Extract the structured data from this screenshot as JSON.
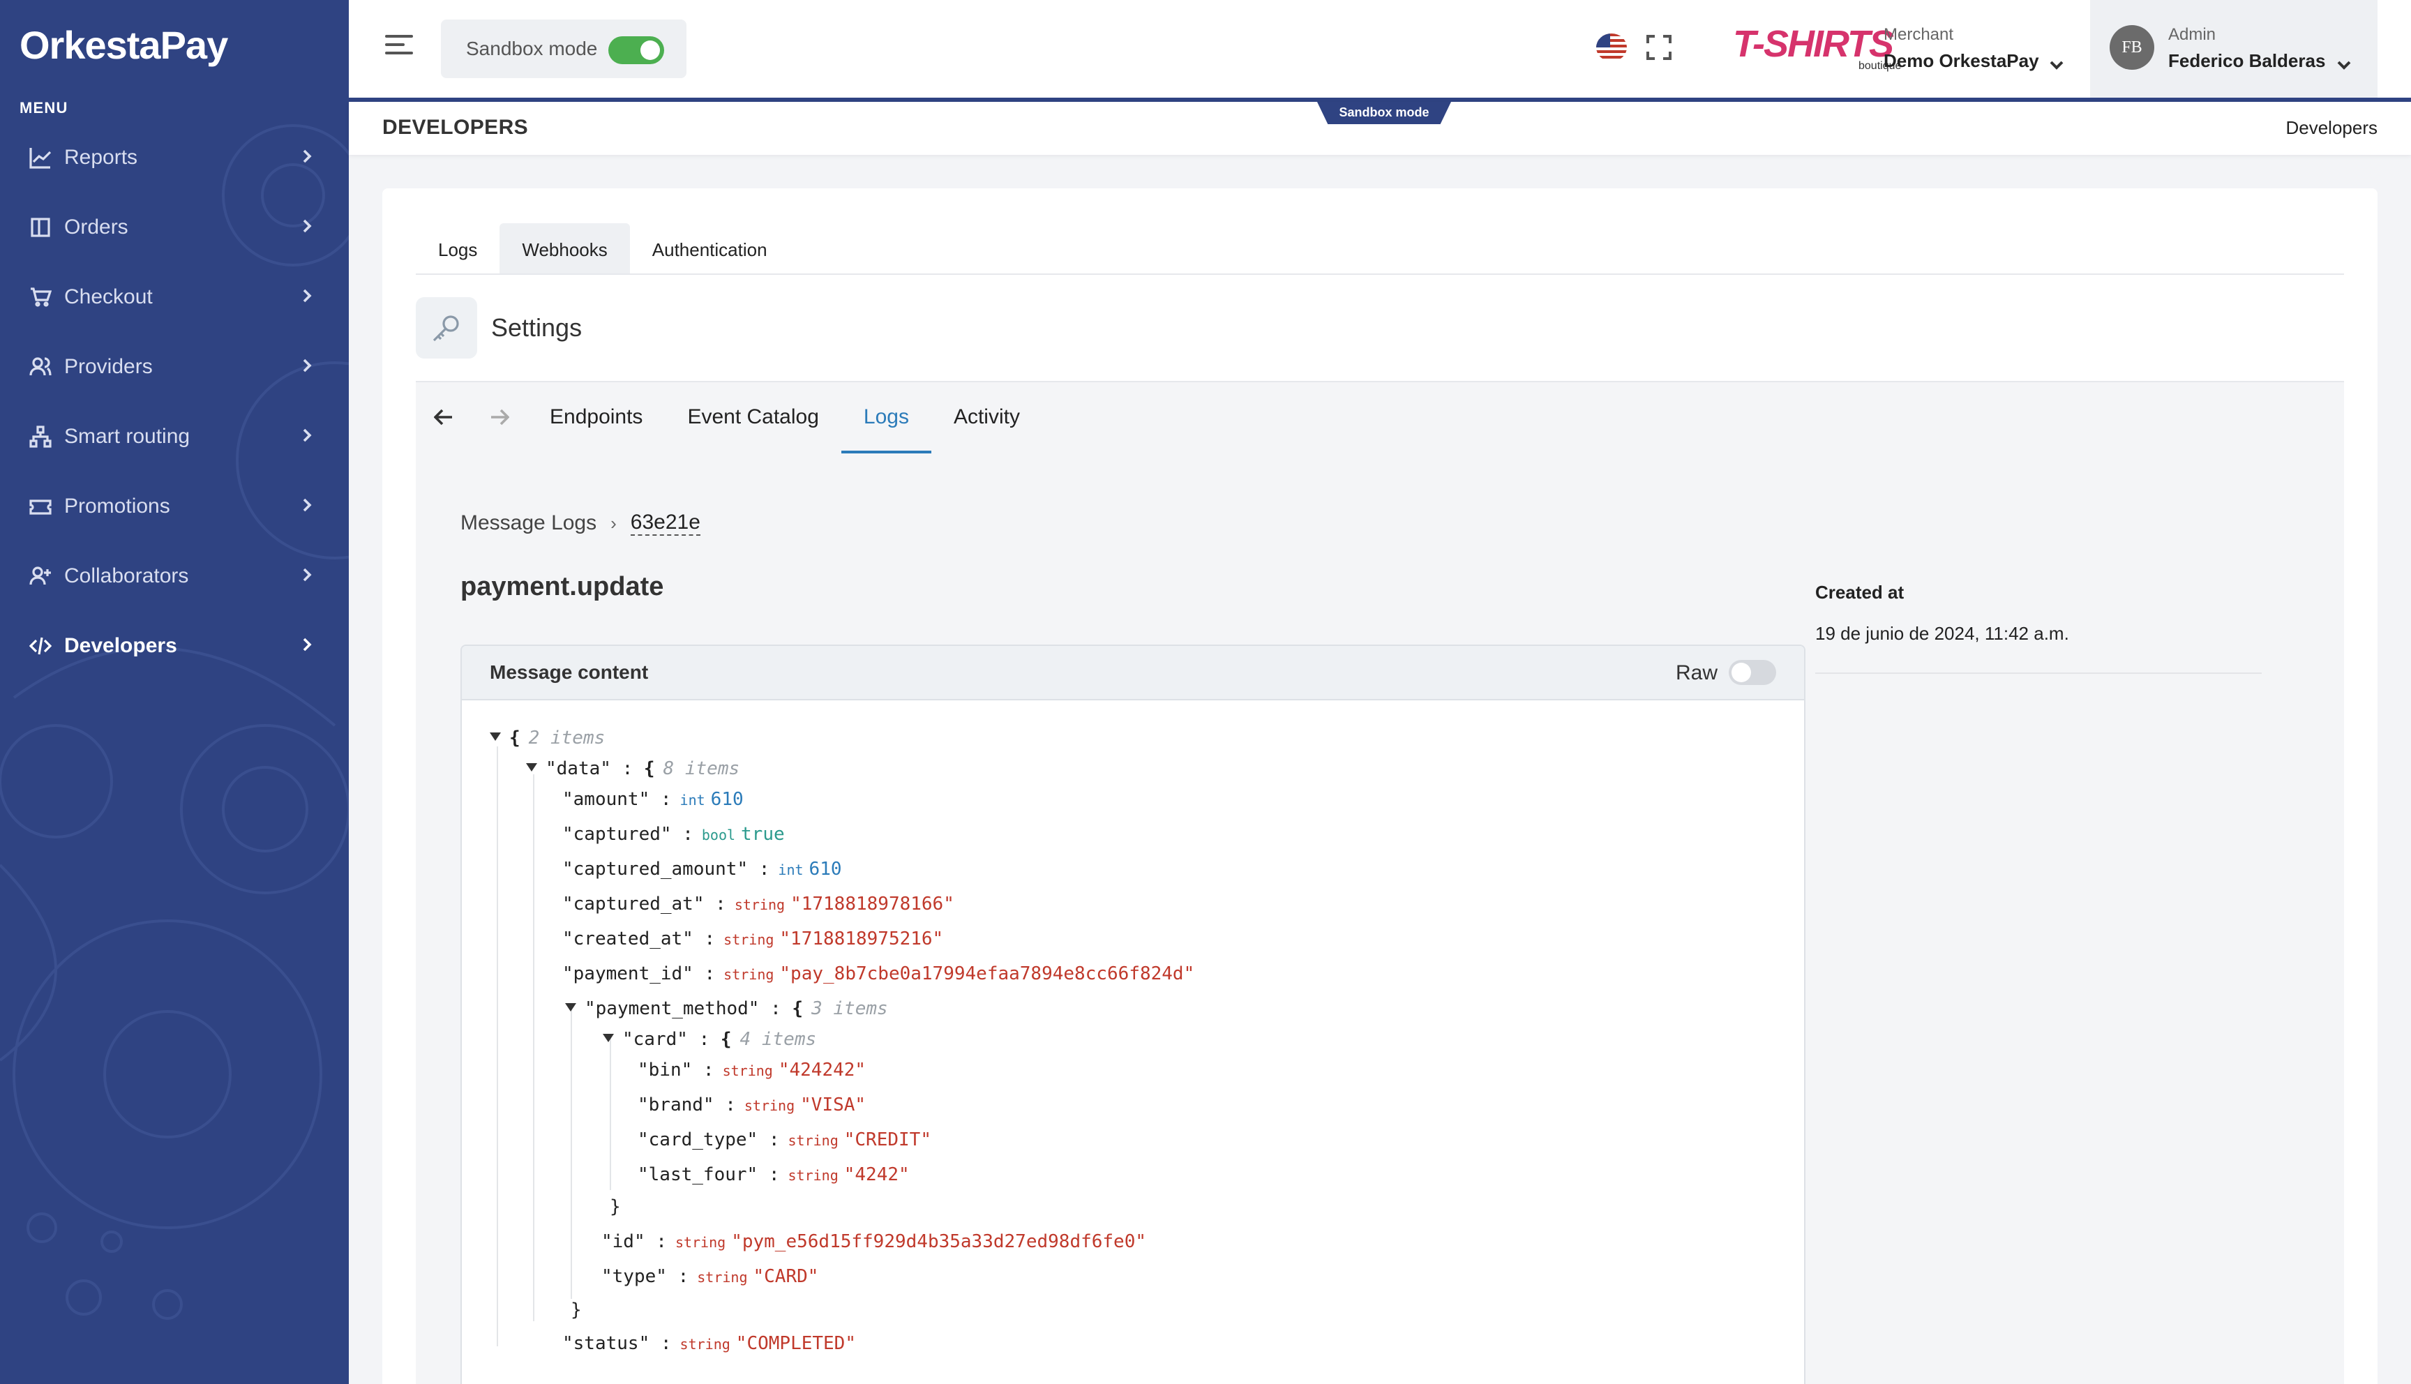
{
  "app": {
    "logo_text_a": "Orkesta",
    "logo_text_b": "Pay",
    "menu_title": "MENU"
  },
  "sidebar": {
    "items": [
      {
        "label": "Reports",
        "icon": "chart-line-icon"
      },
      {
        "label": "Orders",
        "icon": "book-icon"
      },
      {
        "label": "Checkout",
        "icon": "cart-icon"
      },
      {
        "label": "Providers",
        "icon": "users-icon"
      },
      {
        "label": "Smart routing",
        "icon": "sitemap-icon"
      },
      {
        "label": "Promotions",
        "icon": "ticket-icon"
      },
      {
        "label": "Collaborators",
        "icon": "user-plus-icon"
      },
      {
        "label": "Developers",
        "icon": "code-icon",
        "active": true
      }
    ]
  },
  "topbar": {
    "sandbox_label": "Sandbox mode",
    "sandbox_on": true,
    "brand_logo": "T-SHIRTS",
    "brand_sub": "boutique",
    "merchant_label": "Merchant",
    "merchant_value": "Demo OrkestaPay",
    "admin_initials": "FB",
    "admin_label": "Admin",
    "admin_name": "Federico Balderas",
    "accent_color": "#2f4382"
  },
  "page": {
    "title": "DEVELOPERS",
    "crumb": "Developers",
    "sandbox_tab": "Sandbox mode"
  },
  "tabs": {
    "top": [
      "Logs",
      "Webhooks",
      "Authentication"
    ],
    "top_active": "Webhooks",
    "settings_title": "Settings",
    "sub": [
      "Endpoints",
      "Event Catalog",
      "Logs",
      "Activity"
    ],
    "sub_active": "Logs"
  },
  "log": {
    "breadcrumb_root": "Message Logs",
    "breadcrumb_id": "63e21e",
    "event": "payment.update",
    "message_content_label": "Message content",
    "raw_label": "Raw",
    "created_label": "Created at",
    "created_value": "19 de junio de 2024, 11:42 a.m."
  },
  "json_view": {
    "root_count": "2 items",
    "data_key": "\"data\"",
    "data_count": "8 items",
    "amount": {
      "key": "\"amount\"",
      "type": "int",
      "value": "610"
    },
    "captured": {
      "key": "\"captured\"",
      "type": "bool",
      "value": "true"
    },
    "captured_amount": {
      "key": "\"captured_amount\"",
      "type": "int",
      "value": "610"
    },
    "captured_at": {
      "key": "\"captured_at\"",
      "type": "string",
      "value": "\"1718818978166\""
    },
    "created_at": {
      "key": "\"created_at\"",
      "type": "string",
      "value": "\"1718818975216\""
    },
    "payment_id": {
      "key": "\"payment_id\"",
      "type": "string",
      "value": "\"pay_8b7cbe0a17994efaa7894e8cc66f824d\""
    },
    "payment_method_key": "\"payment_method\"",
    "payment_method_count": "3 items",
    "card_key": "\"card\"",
    "card_count": "4 items",
    "bin": {
      "key": "\"bin\"",
      "type": "string",
      "value": "\"424242\""
    },
    "brand": {
      "key": "\"brand\"",
      "type": "string",
      "value": "\"VISA\""
    },
    "card_type": {
      "key": "\"card_type\"",
      "type": "string",
      "value": "\"CREDIT\""
    },
    "last_four": {
      "key": "\"last_four\"",
      "type": "string",
      "value": "\"4242\""
    },
    "pm_id": {
      "key": "\"id\"",
      "type": "string",
      "value": "\"pym_e56d15ff929d4b35a33d27ed98df6fe0\""
    },
    "pm_type": {
      "key": "\"type\"",
      "type": "string",
      "value": "\"CARD\""
    },
    "status": {
      "key": "\"status\"",
      "type": "string",
      "value": "\"COMPLETED\""
    }
  }
}
